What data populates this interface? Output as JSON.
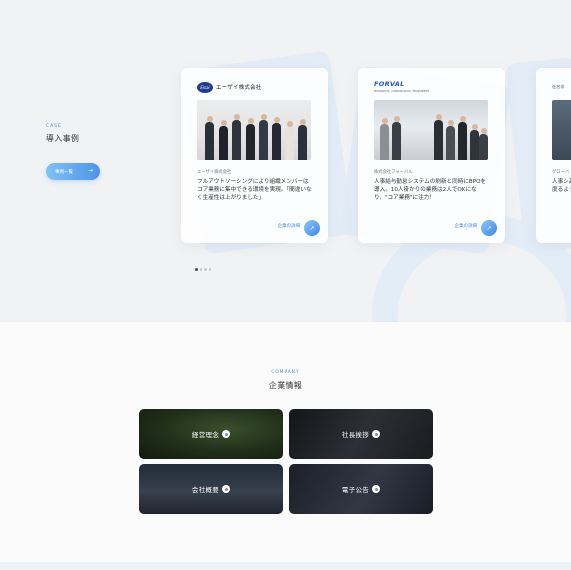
{
  "case": {
    "eyebrow": "CASE",
    "title": "導入事例",
    "list_button": "事例一覧",
    "cards": [
      {
        "logo_mark": "Eisai",
        "logo_text": "エーザイ株式会社",
        "company": "エーザイ株式会社",
        "description": "フルアウトソーシングにより組織メンバーはコア業務に集中できる環境を実現。「間違いなく生産性は上がりました」",
        "detail_link": "企業の詳細"
      },
      {
        "logo_text": "FORVAL",
        "logo_sub": "INFORMATION · COMMUNICATION · ENVIRONMENT",
        "company": "株式会社フォーバル",
        "description": "人事給与勤怠システムの刷新と同時にBPOを導入。10人掛かりの業務は2人でOKになり、\"コア業務\"に注力！",
        "detail_link": "企業の詳細"
      },
      {
        "logo_text": "社名非",
        "company": "グローバ",
        "description": "人事シ高速度るよう"
      }
    ],
    "pagination": {
      "total": 4,
      "active": 0
    }
  },
  "company_info": {
    "eyebrow": "COMPANY",
    "title": "企業情報",
    "tiles": [
      {
        "label": "経営理念"
      },
      {
        "label": "社長挨拶"
      },
      {
        "label": "会社概要"
      },
      {
        "label": "電子公告"
      }
    ]
  },
  "colors": {
    "accent": "#4a8fe0",
    "button_gradient_start": "#80c2f2",
    "button_gradient_end": "#4d94ea"
  }
}
